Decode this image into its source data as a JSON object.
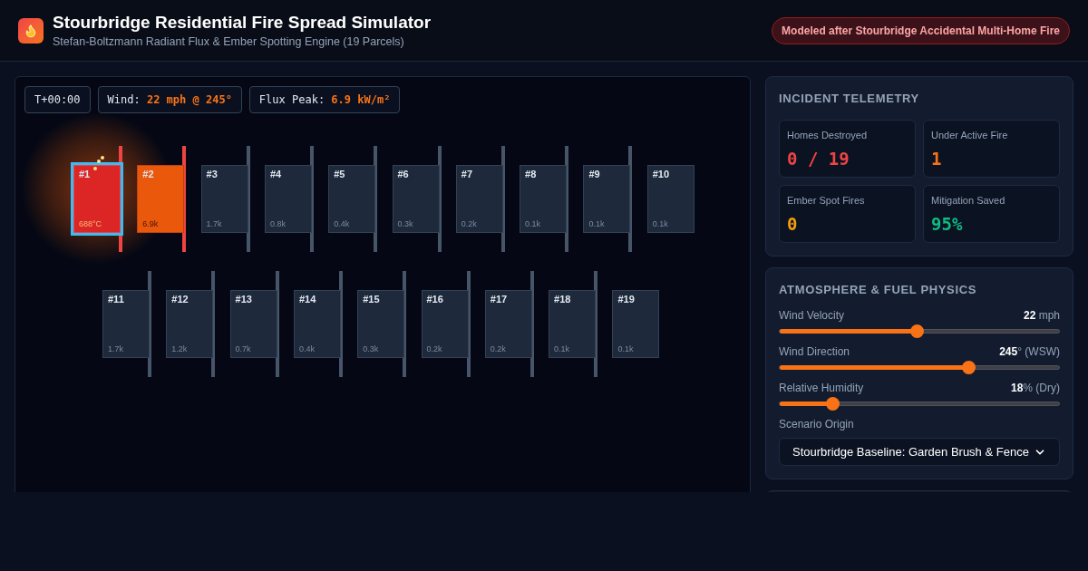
{
  "header": {
    "title": "Stourbridge Residential Fire Spread Simulator",
    "subtitle": "Stefan-Boltzmann Radiant Flux & Ember Spotting Engine (19 Parcels)",
    "badge": "Modeled after Stourbridge Accidental Multi-Home Fire"
  },
  "simulation": {
    "chips": [
      {
        "label": "T+00:00"
      },
      {
        "label": "Wind: ",
        "value": "22 mph @ 245°"
      },
      {
        "label": "Flux Peak: ",
        "value": "6.9 kW/m²"
      }
    ],
    "rows": [
      [
        {
          "label": "#1",
          "reading": "688°C",
          "kind": "burning",
          "selected": true,
          "fence": true,
          "embers": true
        },
        {
          "label": "#2",
          "reading": "6.9k",
          "kind": "igniting",
          "selected": false,
          "fence": true,
          "embers": false
        },
        {
          "label": "#3",
          "reading": "1.7k",
          "kind": "intact",
          "selected": false,
          "fence": true,
          "embers": false
        },
        {
          "label": "#4",
          "reading": "0.8k",
          "kind": "intact",
          "selected": false,
          "fence": true,
          "embers": false
        },
        {
          "label": "#5",
          "reading": "0.4k",
          "kind": "intact",
          "selected": false,
          "fence": true,
          "embers": false
        },
        {
          "label": "#6",
          "reading": "0.3k",
          "kind": "intact",
          "selected": false,
          "fence": true,
          "embers": false
        },
        {
          "label": "#7",
          "reading": "0.2k",
          "kind": "intact",
          "selected": false,
          "fence": true,
          "embers": false
        },
        {
          "label": "#8",
          "reading": "0.1k",
          "kind": "intact",
          "selected": false,
          "fence": true,
          "embers": false
        },
        {
          "label": "#9",
          "reading": "0.1k",
          "kind": "intact",
          "selected": false,
          "fence": true,
          "embers": false
        },
        {
          "label": "#10",
          "reading": "0.1k",
          "kind": "intact",
          "selected": false,
          "fence": false,
          "embers": false
        }
      ],
      [
        {
          "label": "#11",
          "reading": "1.7k",
          "kind": "intact",
          "selected": false,
          "fence": true,
          "embers": false
        },
        {
          "label": "#12",
          "reading": "1.2k",
          "kind": "intact",
          "selected": false,
          "fence": true,
          "embers": false
        },
        {
          "label": "#13",
          "reading": "0.7k",
          "kind": "intact",
          "selected": false,
          "fence": true,
          "embers": false
        },
        {
          "label": "#14",
          "reading": "0.4k",
          "kind": "intact",
          "selected": false,
          "fence": true,
          "embers": false
        },
        {
          "label": "#15",
          "reading": "0.3k",
          "kind": "intact",
          "selected": false,
          "fence": true,
          "embers": false
        },
        {
          "label": "#16",
          "reading": "0.2k",
          "kind": "intact",
          "selected": false,
          "fence": true,
          "embers": false
        },
        {
          "label": "#17",
          "reading": "0.2k",
          "kind": "intact",
          "selected": false,
          "fence": true,
          "embers": false
        },
        {
          "label": "#18",
          "reading": "0.1k",
          "kind": "intact",
          "selected": false,
          "fence": true,
          "embers": false
        },
        {
          "label": "#19",
          "reading": "0.1k",
          "kind": "intact",
          "selected": false,
          "fence": false,
          "embers": false
        }
      ]
    ]
  },
  "telemetry": {
    "title": "INCIDENT TELEMETRY",
    "stats": [
      {
        "label": "Homes Destroyed",
        "value": "0 / 19",
        "color": "#ef4444"
      },
      {
        "label": "Under Active Fire",
        "value": "1",
        "color": "#f97316"
      },
      {
        "label": "Ember Spot Fires",
        "value": "0",
        "color": "#f59e0b"
      },
      {
        "label": "Mitigation Saved",
        "value": "95%",
        "color": "#10b981"
      }
    ]
  },
  "physics": {
    "title": "ATMOSPHERE & FUEL PHYSICS",
    "sliders": [
      {
        "label": "Wind Velocity",
        "value": "22",
        "unit": " mph",
        "level": 0.49
      },
      {
        "label": "Wind Direction",
        "value": "245",
        "unit": "° (WSW)",
        "level": 0.675
      },
      {
        "label": "Relative Humidity",
        "value": "18",
        "unit": "% (Dry)",
        "level": 0.19
      }
    ],
    "scenario": {
      "label": "Scenario Origin",
      "value": "Stourbridge Baseline: Garden Brush & Fence"
    }
  }
}
